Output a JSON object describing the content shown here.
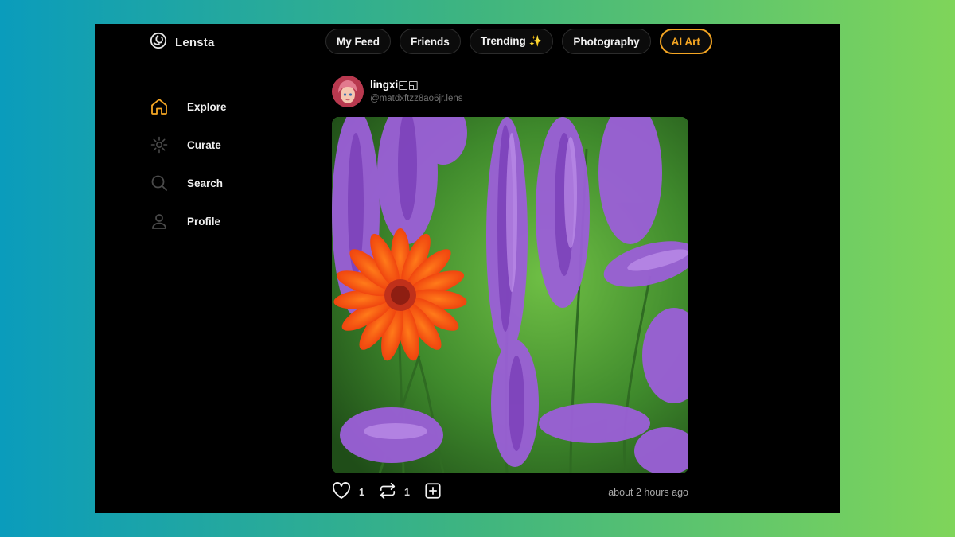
{
  "app": {
    "name": "Lensta"
  },
  "tabs": [
    {
      "label": "My Feed"
    },
    {
      "label": "Friends"
    },
    {
      "label": "Trending ✨"
    },
    {
      "label": "Photography"
    },
    {
      "label": "AI Art",
      "active": true
    }
  ],
  "sidebar": {
    "items": [
      {
        "label": "Explore",
        "icon": "home-icon",
        "active": true
      },
      {
        "label": "Curate",
        "icon": "sparkle-icon"
      },
      {
        "label": "Search",
        "icon": "search-icon"
      },
      {
        "label": "Profile",
        "icon": "user-icon"
      }
    ]
  },
  "post": {
    "author": {
      "name": "lingxi◱◱",
      "handle": "@matdxftzz8ao6jr.lens"
    },
    "likes": "1",
    "mirrors": "1",
    "timestamp": "about 2 hours ago"
  },
  "colors": {
    "accent": "#f5a623",
    "background": "#000000",
    "muted": "#6f6f6f"
  }
}
